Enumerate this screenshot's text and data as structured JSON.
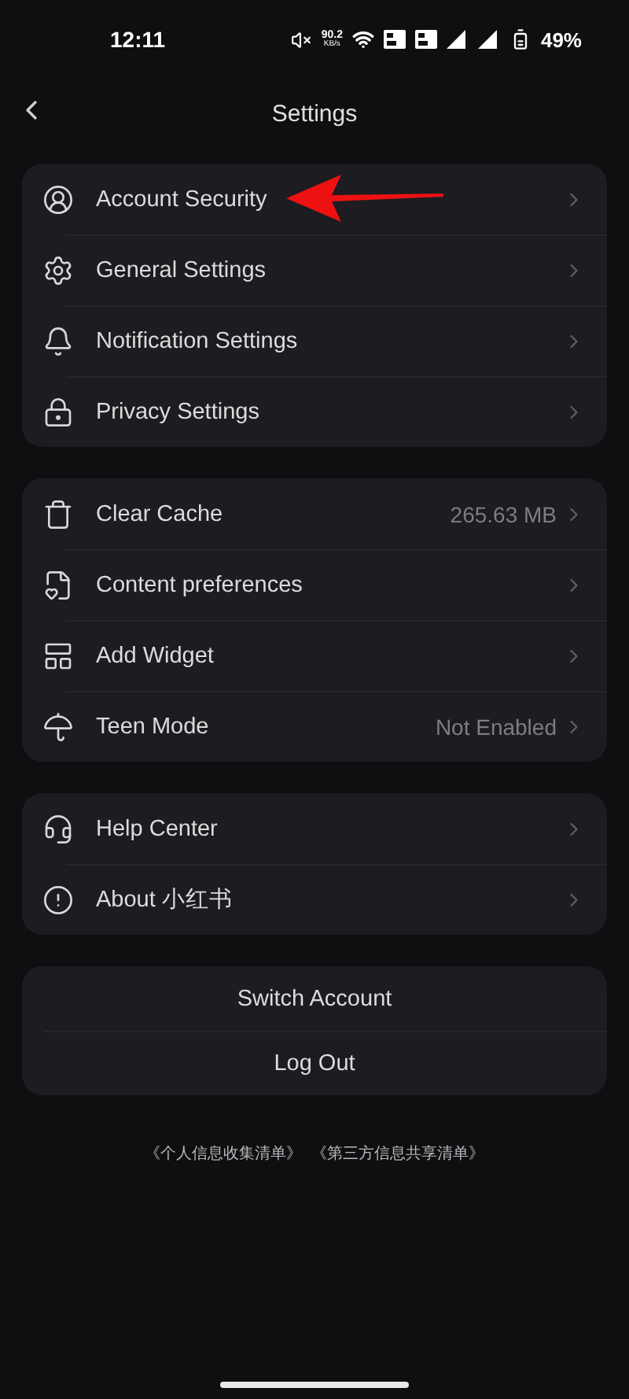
{
  "status_bar": {
    "time": "12:11",
    "speed_value": "90.2",
    "speed_unit": "KB/s",
    "battery": "49%"
  },
  "header": {
    "title": "Settings"
  },
  "groups": [
    {
      "items": [
        {
          "label": "Account Security"
        },
        {
          "label": "General Settings"
        },
        {
          "label": "Notification Settings"
        },
        {
          "label": "Privacy Settings"
        }
      ]
    },
    {
      "items": [
        {
          "label": "Clear Cache",
          "value": "265.63 MB"
        },
        {
          "label": "Content preferences"
        },
        {
          "label": "Add Widget"
        },
        {
          "label": "Teen Mode",
          "value": "Not Enabled"
        }
      ]
    },
    {
      "items": [
        {
          "label": "Help Center"
        },
        {
          "label": "About 小红书"
        }
      ]
    }
  ],
  "account_actions": [
    "Switch Account",
    "Log Out"
  ],
  "footer_links": [
    "《个人信息收集清单》",
    "《第三方信息共享清单》"
  ]
}
